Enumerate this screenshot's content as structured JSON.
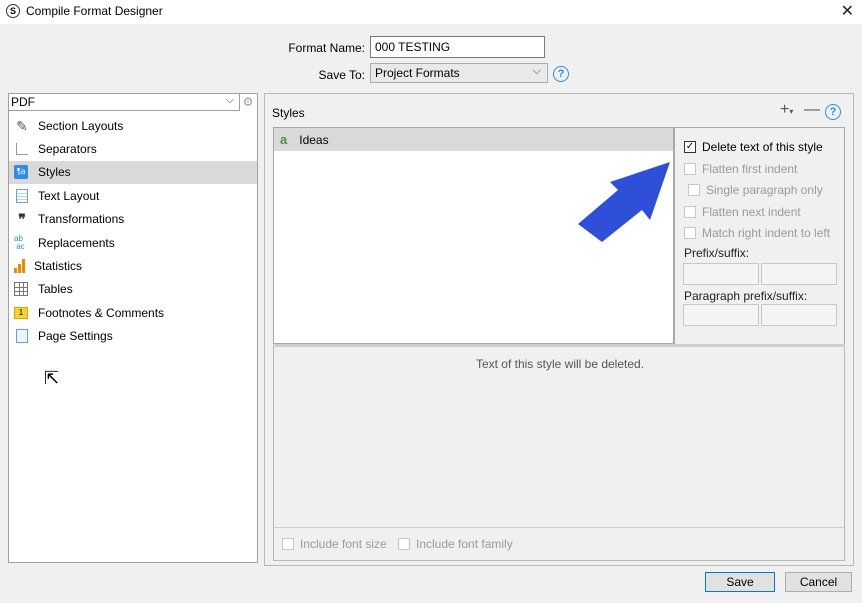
{
  "window": {
    "title": "Compile Format Designer",
    "app_icon_glyph": "S"
  },
  "form": {
    "format_name_label": "Format Name:",
    "format_name_value": "000 TESTING",
    "save_to_label": "Save To:",
    "save_to_value": "Project Formats"
  },
  "left": {
    "output_type": "PDF",
    "items": [
      {
        "label": "Section Layouts",
        "icon": "brush-icon"
      },
      {
        "label": "Separators",
        "icon": "separator-icon"
      },
      {
        "label": "Styles",
        "icon": "styles-icon",
        "selected": true
      },
      {
        "label": "Text Layout",
        "icon": "text-layout-icon"
      },
      {
        "label": "Transformations",
        "icon": "quote-icon"
      },
      {
        "label": "Replacements",
        "icon": "replace-icon"
      },
      {
        "label": "Statistics",
        "icon": "statistics-icon"
      },
      {
        "label": "Tables",
        "icon": "table-icon"
      },
      {
        "label": "Footnotes & Comments",
        "icon": "note-icon"
      },
      {
        "label": "Page Settings",
        "icon": "page-icon"
      }
    ]
  },
  "styles_panel": {
    "title": "Styles",
    "list": [
      {
        "glyph": "a",
        "name": "Ideas"
      }
    ],
    "options": {
      "delete_text": "Delete text of this style",
      "flatten_first": "Flatten first indent",
      "single_paragraph": "Single paragraph only",
      "flatten_next": "Flatten next indent",
      "match_right": "Match right indent to left",
      "prefix_suffix_label": "Prefix/suffix:",
      "para_prefix_suffix_label": "Paragraph prefix/suffix:"
    },
    "preview_text": "Text of this style will be deleted.",
    "include_font_size": "Include font size",
    "include_font_family": "Include font family"
  },
  "buttons": {
    "save": "Save",
    "cancel": "Cancel"
  },
  "colors": {
    "accent": "#2f8de4",
    "arrow": "#2f4fd8",
    "selected_bg": "#d9d9d9"
  }
}
